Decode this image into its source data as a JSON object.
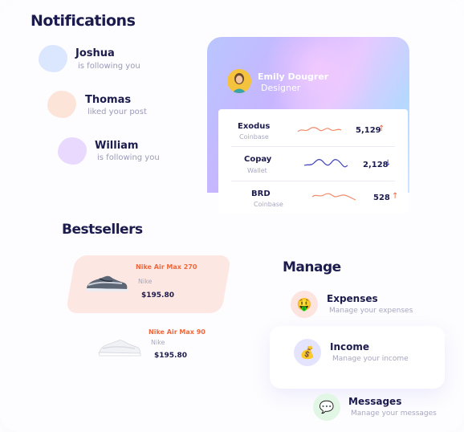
{
  "notifications": {
    "title": "Notifications",
    "items": [
      {
        "name": "Joshua",
        "text": "is following you",
        "color": "#dbe6ff"
      },
      {
        "name": "Thomas",
        "text": "liked your post",
        "color": "#fde4d8"
      },
      {
        "name": "William",
        "text": "is following you",
        "color": "#ead9ff"
      }
    ]
  },
  "wallet": {
    "user_name": "Emily Dougrer",
    "user_role": "Designer",
    "coins": [
      {
        "name": "Exodus",
        "source": "Coinbase",
        "value": "5,129",
        "trend": "up",
        "trend_icon": "↑",
        "color": "#f0683c"
      },
      {
        "name": "Copay",
        "source": "Wallet",
        "value": "2,128",
        "trend": "down",
        "trend_icon": "↓",
        "color": "#3b3fb8"
      },
      {
        "name": "BRD",
        "source": "Coinbase",
        "value": "528",
        "trend": "up",
        "trend_icon": "↑",
        "color": "#f0683c"
      }
    ]
  },
  "bestsellers": {
    "title": "Bestsellers",
    "products": [
      {
        "name": "Nike Air Max 270",
        "brand": "Nike",
        "price": "$195.80"
      },
      {
        "name": "Nike Air Max 90",
        "brand": "Nike",
        "price": "$195.80"
      }
    ]
  },
  "manage": {
    "title": "Manage",
    "items": [
      {
        "title": "Expenses",
        "subtitle": "Manage your expenses",
        "icon": "money-face-icon",
        "glyph": "🤑",
        "color": "#fde4df"
      },
      {
        "title": "Income",
        "subtitle": "Manage your income",
        "icon": "money-bag-icon",
        "glyph": "💰",
        "color": "#e4e4ff"
      },
      {
        "title": "Messages",
        "subtitle": "Manage your messages",
        "icon": "speech-bubble-icon",
        "glyph": "💬",
        "color": "#e2f6e6"
      }
    ]
  }
}
